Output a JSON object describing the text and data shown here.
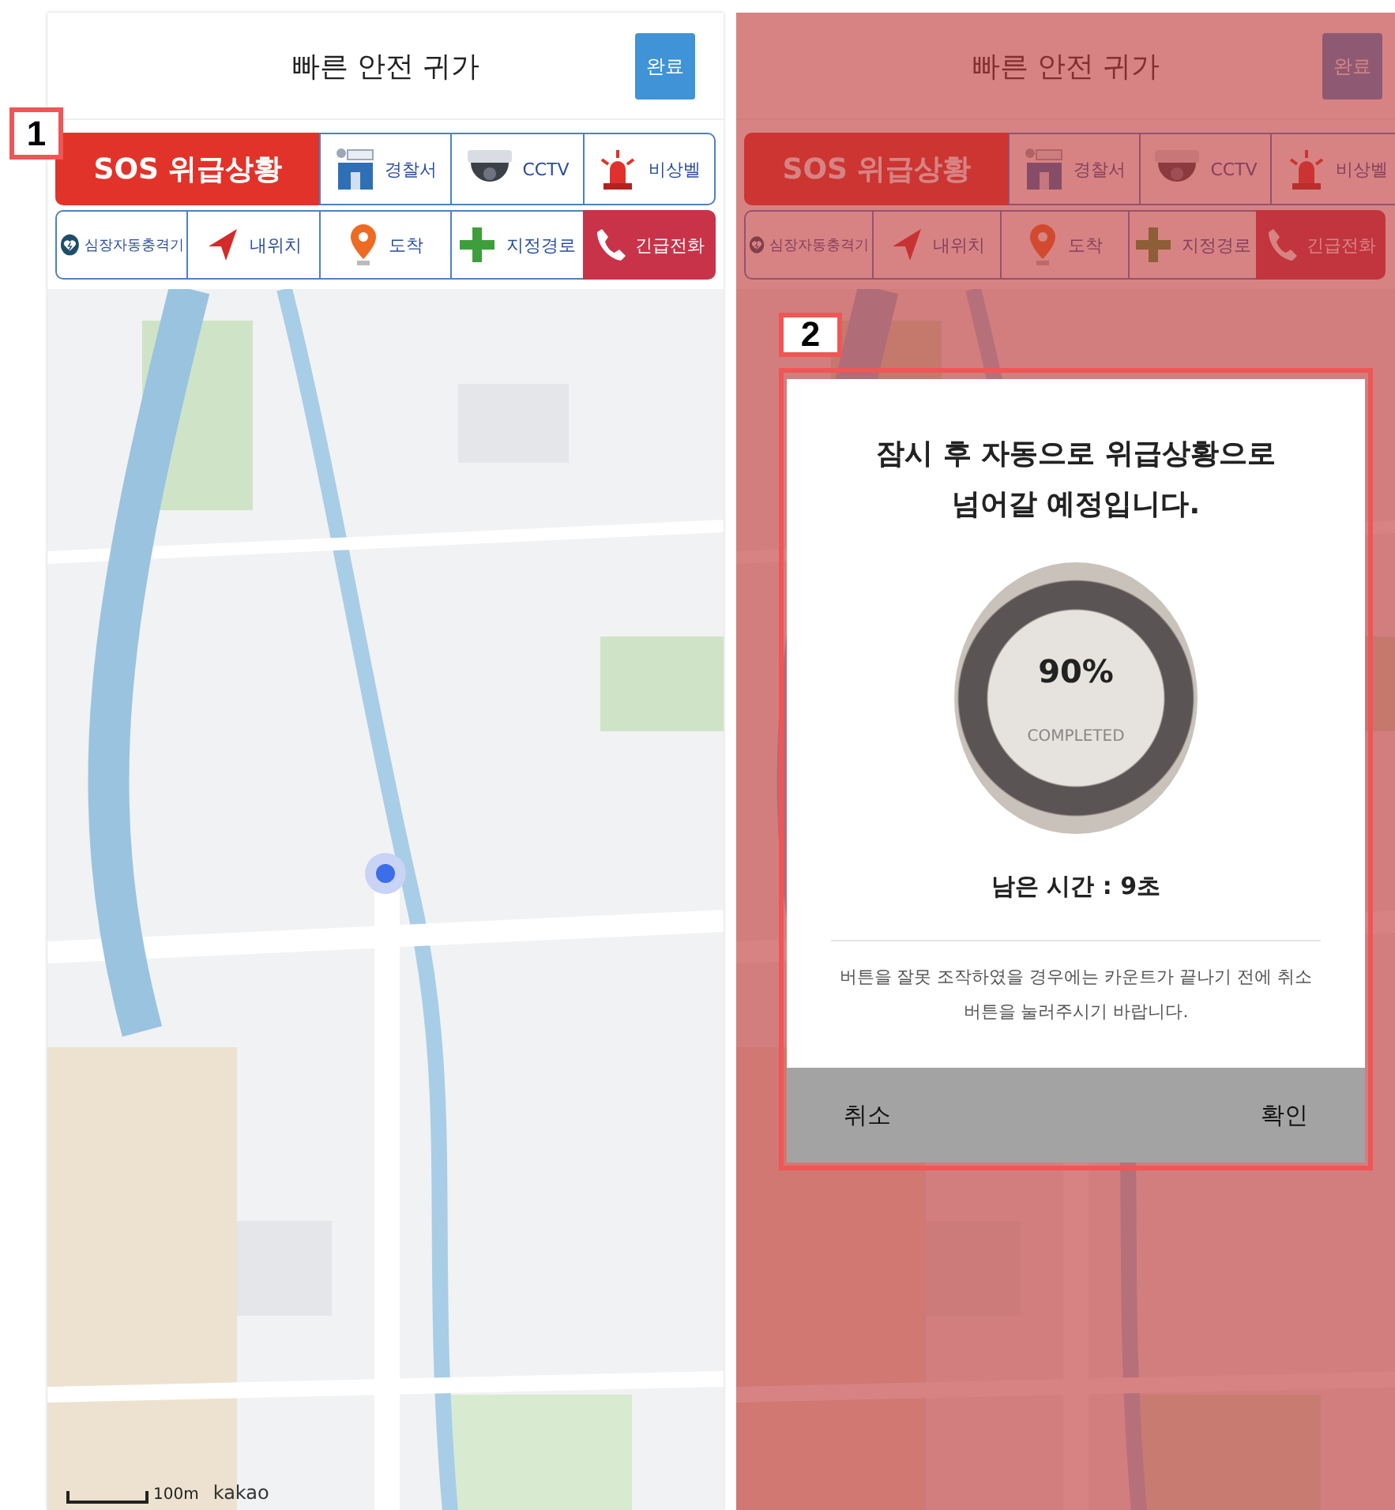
{
  "screens": [
    {
      "header": {
        "title": "빠른 안전 귀가",
        "done_button": "완료"
      },
      "toolbar": {
        "row_1": [
          {
            "label": "SOS 위급상황",
            "kind": "sos"
          },
          {
            "label": "경찰서",
            "kind": "tool"
          },
          {
            "label": "CCTV",
            "kind": "tool"
          },
          {
            "label": "비상벨",
            "kind": "tool"
          }
        ],
        "row_2": [
          {
            "label": "심장자동충격기",
            "kind": "tool"
          },
          {
            "label": "내위치",
            "kind": "tool"
          },
          {
            "label": "도착",
            "kind": "tool"
          },
          {
            "label": "지정경로",
            "kind": "tool"
          },
          {
            "label": "긴급전화",
            "kind": "call"
          }
        ]
      },
      "map": {
        "kind": "picture",
        "scale": "100m",
        "attribution": "kakao"
      },
      "dimmed": false,
      "callout": "1"
    },
    {
      "header": {
        "title": "빠른 안전 귀가",
        "done_button": "완료"
      },
      "toolbar": {
        "row_1": [
          {
            "label": "SOS 위급상황",
            "kind": "sos"
          },
          {
            "label": "경찰서",
            "kind": "tool"
          },
          {
            "label": "CCTV",
            "kind": "tool"
          },
          {
            "label": "비상벨",
            "kind": "tool"
          }
        ],
        "row_2": [
          {
            "label": "심장자동충격기",
            "kind": "tool"
          },
          {
            "label": "내위치",
            "kind": "tool"
          },
          {
            "label": "도착",
            "kind": "tool"
          },
          {
            "label": "지정경로",
            "kind": "tool"
          },
          {
            "label": "긴급전화",
            "kind": "call"
          }
        ]
      },
      "dimmed": true,
      "callout": "2",
      "dialog": {
        "title": "잠시 후 자동으로 위급상황으로 넘어갈 예정입니다.",
        "percent": "90%",
        "progress_caption": "COMPLETED",
        "remaining": "남은 시간 : 9초",
        "notice": "버튼을 잘못 조작하였을 경우에는 카운트가 끝나기 전에 취소 버튼을 눌러주시기 바랍니다.",
        "buttons": [
          "취소",
          "확인"
        ]
      }
    }
  ]
}
